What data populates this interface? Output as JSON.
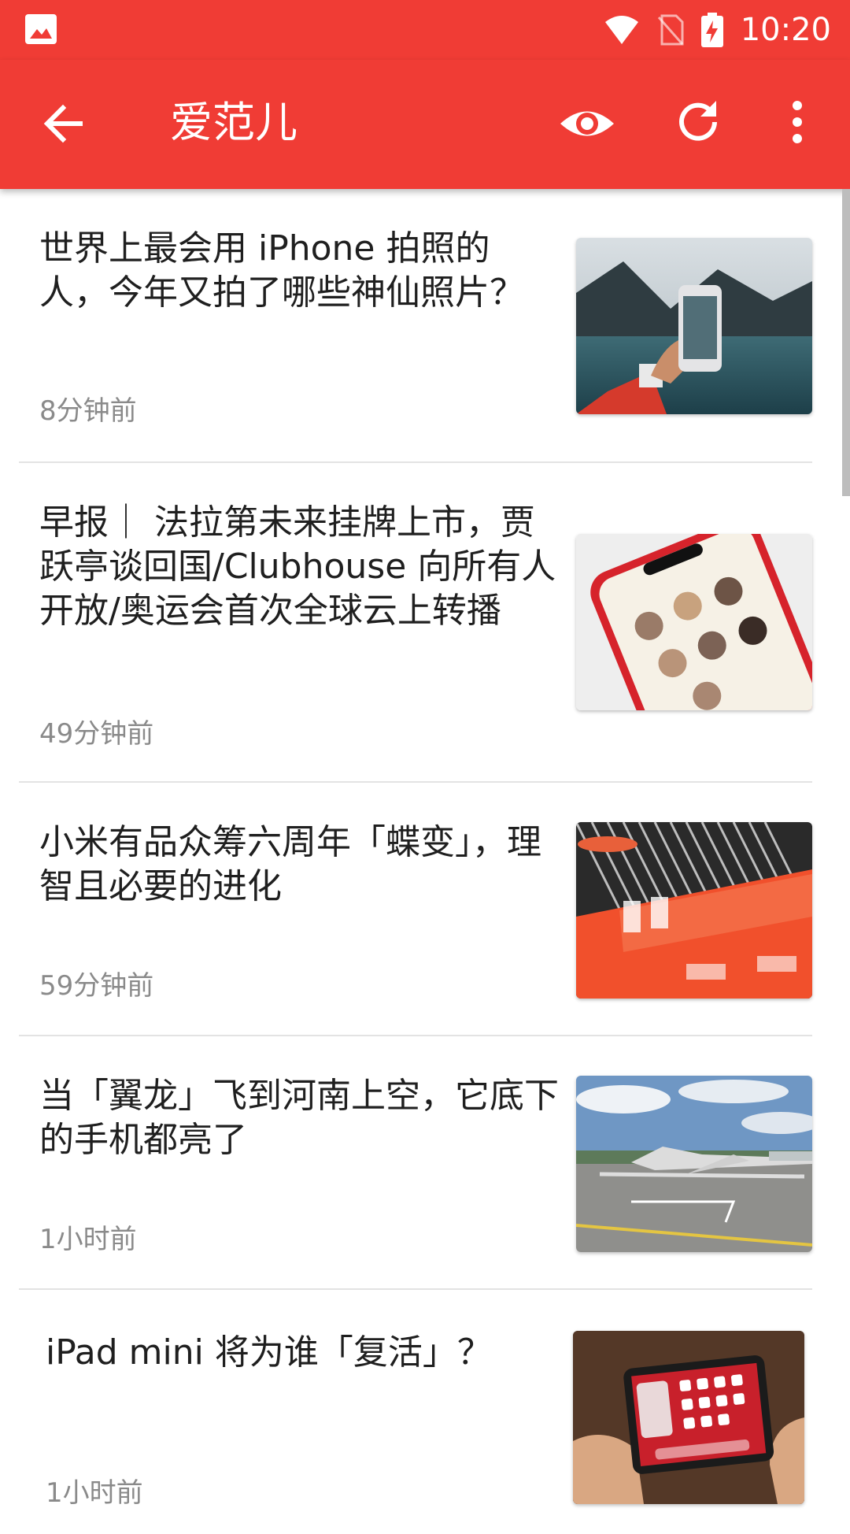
{
  "status_bar": {
    "time": "10:20",
    "icons": [
      "image-notification-icon",
      "wifi-icon",
      "no-sim-icon",
      "battery-charging-icon"
    ]
  },
  "app_bar": {
    "title": "爱范儿",
    "actions": [
      "back-arrow-icon",
      "eye-icon",
      "refresh-icon",
      "more-vert-icon"
    ]
  },
  "colors": {
    "primary": "#f03c35",
    "text": "#1f1f1f",
    "secondary_text": "#8a8a8a",
    "divider": "#e3e3e3"
  },
  "articles": [
    {
      "title": "世界上最会用 iPhone 拍照的人，今年又拍了哪些神仙照片？",
      "time": "8分钟前",
      "thumb": "iphone-lake-photo"
    },
    {
      "title": "早报｜ 法拉第未来挂牌上市，贾跃亭谈回国/Clubhouse 向所有人开放/奥运会首次全球云上转播",
      "time": "49分钟前",
      "thumb": "clubhouse-phone-photo"
    },
    {
      "title": "小米有品众筹六周年「蝶变」，理智且必要的进化",
      "time": "59分钟前",
      "thumb": "youpin-wall-photo"
    },
    {
      "title": "当「翼龙」飞到河南上空，它底下的手机都亮了",
      "time": "1小时前",
      "thumb": "drone-airfield-photo"
    },
    {
      "title": "iPad mini 将为谁「复活」？",
      "time": "1小时前",
      "thumb": "ipad-hands-photo"
    }
  ]
}
